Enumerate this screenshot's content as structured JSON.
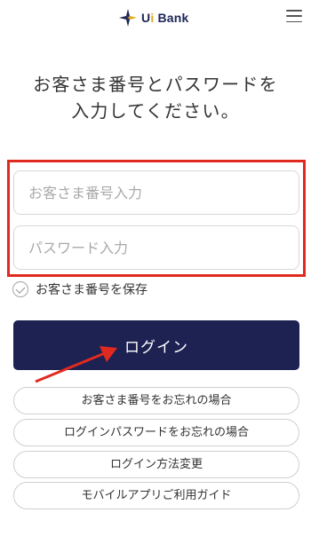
{
  "header": {
    "brand_prefix": "U",
    "brand_i": "i",
    "brand_suffix": "Bank",
    "menu_icon": "hamburger-menu-icon"
  },
  "main": {
    "title_line1": "お客さま番号とパスワードを",
    "title_line2": "入力してください。",
    "customer_number": {
      "value": "",
      "placeholder": "お客さま番号入力"
    },
    "password": {
      "value": "",
      "placeholder": "パスワード入力"
    },
    "save_label": "お客さま番号を保存",
    "login_label": "ログイン"
  },
  "links": [
    {
      "label": "お客さま番号をお忘れの場合"
    },
    {
      "label": "ログインパスワードをお忘れの場合"
    },
    {
      "label": "ログイン方法変更"
    },
    {
      "label": "モバイルアプリご利用ガイド"
    }
  ],
  "colors": {
    "brand_navy": "#1d2253",
    "highlight_red": "#e12a1f",
    "arrow_red": "#e12a1f",
    "brand_gold": "#e3a71a"
  }
}
